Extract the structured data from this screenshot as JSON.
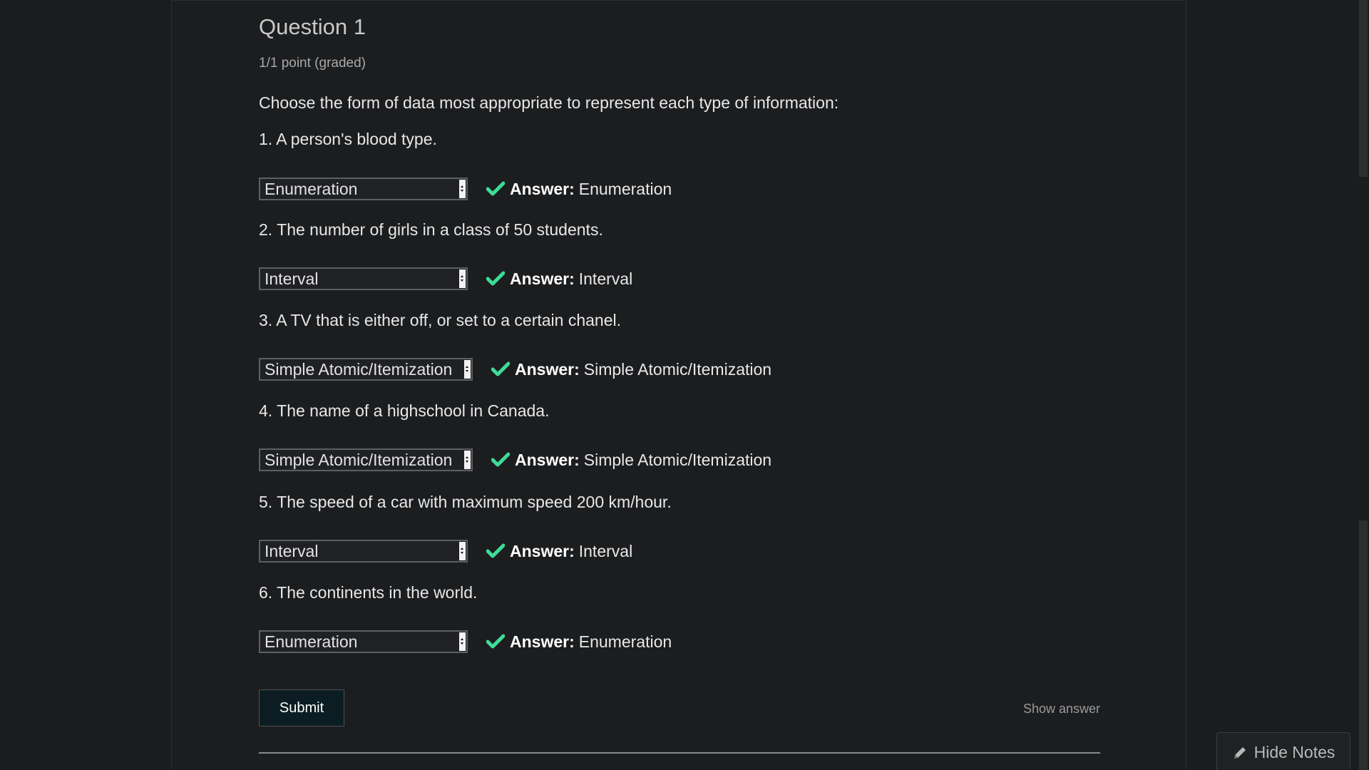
{
  "question": {
    "title": "Question 1",
    "points": "1/1 point (graded)",
    "instruction": "Choose the form of data most appropriate to represent each type of information:",
    "answer_label": "Answer:",
    "items": [
      {
        "prompt": "1. A person's blood type.",
        "selected": "Enumeration",
        "answer": "Enumeration"
      },
      {
        "prompt": "2. The number of girls in a class of 50 students.",
        "selected": "Interval",
        "answer": "Interval"
      },
      {
        "prompt": "3. A TV that is either off, or set to a certain chanel.",
        "selected": "Simple Atomic/Itemization",
        "answer": "Simple Atomic/Itemization"
      },
      {
        "prompt": "4. The name of a highschool in Canada.",
        "selected": "Simple Atomic/Itemization",
        "answer": "Simple Atomic/Itemization"
      },
      {
        "prompt": "5. The speed of a car with maximum speed 200 km/hour.",
        "selected": "Interval",
        "answer": "Interval"
      },
      {
        "prompt": "6. The continents in the world.",
        "selected": "Enumeration",
        "answer": "Enumeration"
      }
    ]
  },
  "actions": {
    "submit_label": "Submit",
    "show_answer_label": "Show answer"
  },
  "notes": {
    "toggle_label": "Hide Notes",
    "icon": "pencil-icon"
  },
  "colors": {
    "background": "#1b1c1d",
    "check": "#3ddc97",
    "submit_bg": "#0b1d22"
  }
}
